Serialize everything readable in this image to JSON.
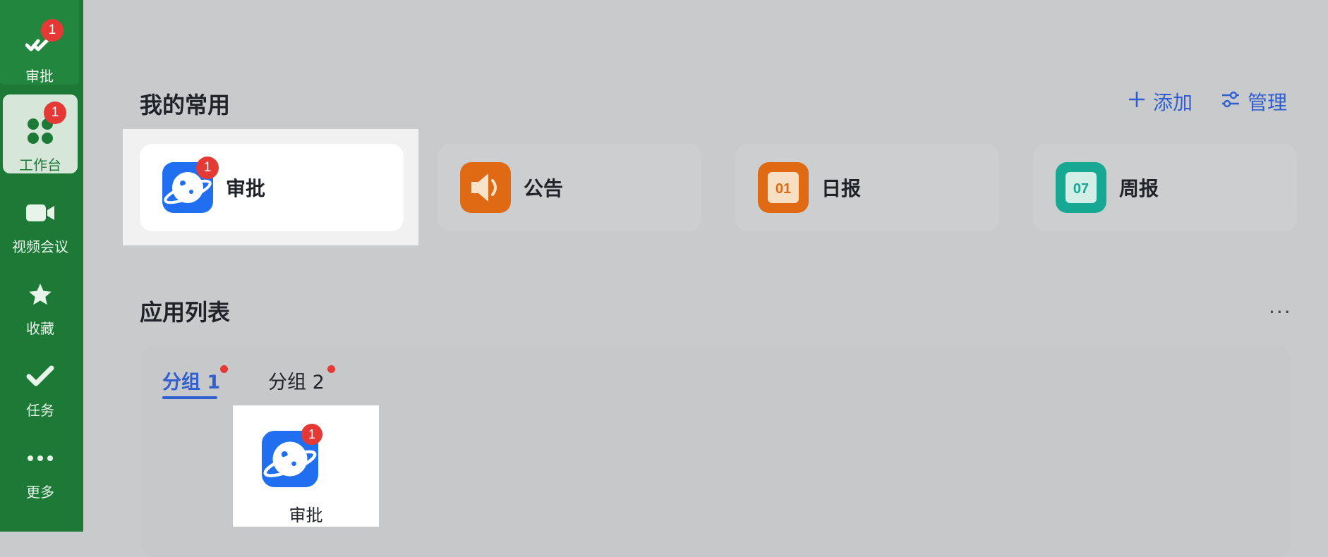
{
  "sidebar": {
    "items": [
      {
        "label": "审批",
        "icon": "approval-check-icon",
        "badge": "1"
      },
      {
        "label": "工作台",
        "icon": "workbench-grid-icon",
        "badge": "1"
      },
      {
        "label": "视频会议",
        "icon": "video-camera-icon"
      },
      {
        "label": "收藏",
        "icon": "star-icon"
      },
      {
        "label": "任务",
        "icon": "task-check-icon"
      },
      {
        "label": "更多",
        "icon": "more-dots-icon"
      }
    ]
  },
  "favorites": {
    "title": "我的常用",
    "add_label": "添加",
    "manage_label": "管理",
    "apps": [
      {
        "name": "审批",
        "icon": "approval-planet-icon",
        "badge": "1"
      },
      {
        "name": "公告",
        "icon": "announcement-speaker-icon"
      },
      {
        "name": "日报",
        "icon": "daily-report-calendar-icon",
        "day": "01"
      },
      {
        "name": "周报",
        "icon": "weekly-report-calendar-icon",
        "day": "07"
      }
    ]
  },
  "app_list": {
    "title": "应用列表",
    "more": "···",
    "tabs": [
      {
        "label": "分组 1"
      },
      {
        "label": "分组 2"
      }
    ],
    "apps": [
      {
        "name": "审批",
        "icon": "approval-planet-icon",
        "badge": "1"
      }
    ]
  },
  "colors": {
    "sidebar": "#1d7a36",
    "accent": "#2f5fd0",
    "badge": "#e53935"
  }
}
